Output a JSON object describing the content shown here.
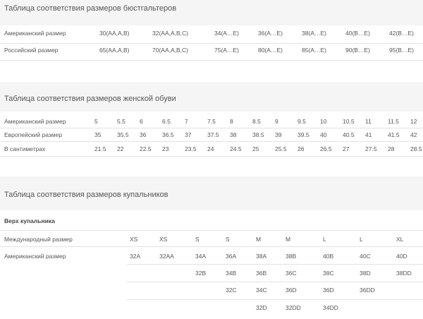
{
  "bra": {
    "title": "Таблица соответствия размеров бюстгальтеров",
    "rows": [
      {
        "label": "Американский размер",
        "cells": [
          "30(AA,A,B)",
          "32(AA,A,B,C)",
          "34(A…E)",
          "36(A…E)",
          "38(A…E)",
          "40(B…E)",
          "42(B…E)"
        ]
      },
      {
        "label": "Российский размер",
        "cells": [
          "65(AA,A,B)",
          "70(AA,A,B,C)",
          "75(A…E)",
          "80(A…E)",
          "85(A…E)",
          "90(B…E)",
          "95(B…E)"
        ]
      }
    ]
  },
  "shoes": {
    "title": "Таблица соответствия размеров женской обуви",
    "rows": [
      {
        "label": "Американский размер",
        "cells": [
          "5",
          "5.5",
          "6",
          "6.5",
          "7",
          "7.5",
          "8",
          "8.5",
          "9",
          "9.5",
          "10",
          "10.5",
          "11",
          "11.5",
          "12"
        ]
      },
      {
        "label": "Европейский размер",
        "cells": [
          "35",
          "35.5",
          "36",
          "36.5",
          "37",
          "37.5",
          "38",
          "38.5",
          "39",
          "39.5",
          "40",
          "40.5",
          "41",
          "41.5",
          "42"
        ]
      },
      {
        "label": "В сантиметрах",
        "cells": [
          "21.5",
          "22",
          "22.5",
          "23",
          "23.5",
          "24",
          "24.5",
          "25",
          "25.5",
          "26",
          "26.5",
          "27",
          "27.5",
          "28",
          "28.5"
        ]
      }
    ]
  },
  "swim": {
    "title": "Таблица соответствия размеров купальников",
    "subtitle": "Верх купальника",
    "header": {
      "label": "Международный размер",
      "cells": [
        "XS",
        "XS",
        "S",
        "S",
        "M",
        "M",
        "L",
        "L",
        "XL"
      ]
    },
    "us_label": "Американский размер",
    "us_rows": [
      [
        "32A",
        "32AA",
        "34A",
        "36A",
        "38A",
        "38B",
        "40B",
        "40C",
        "40D"
      ],
      [
        "",
        "",
        "32B",
        "34B",
        "36B",
        "36C",
        "38C",
        "38D",
        "38DD"
      ],
      [
        "",
        "",
        "",
        "32C",
        "34C",
        "36D",
        "36D",
        "36DD",
        ""
      ],
      [
        "",
        "",
        "",
        "",
        "32D",
        "32DD",
        "34DD",
        "",
        ""
      ]
    ]
  }
}
